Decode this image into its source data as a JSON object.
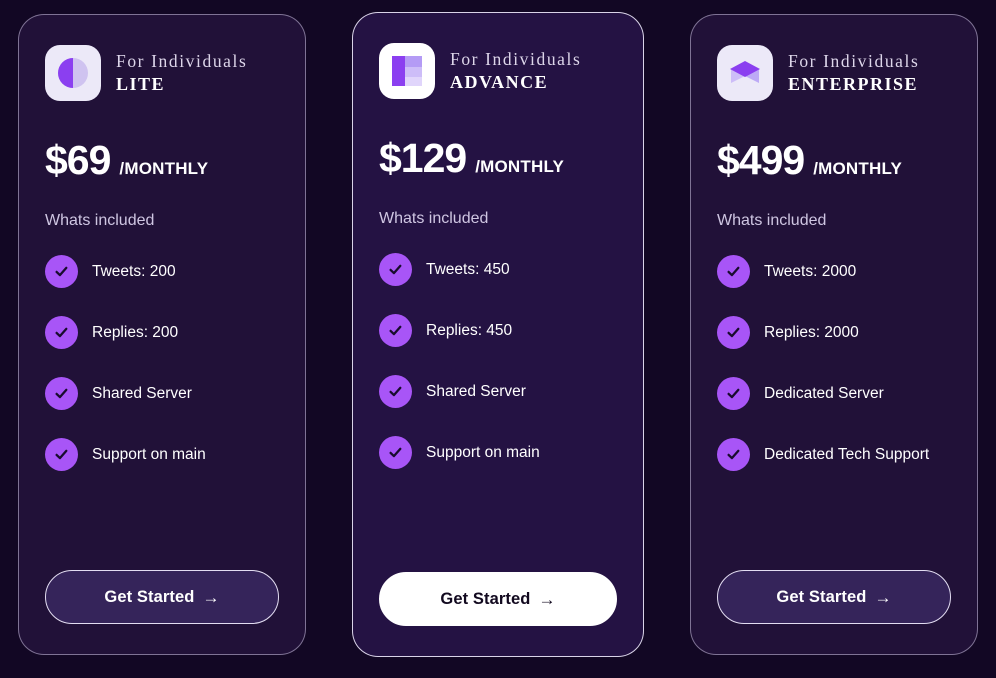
{
  "theme": {
    "page_background": "#120724",
    "card_background": "#211138",
    "featured_card_background": "#241243",
    "accent": "#a855f7",
    "text_primary": "#ffffff",
    "text_muted": "#cfc6e2"
  },
  "plans": [
    {
      "icon_name": "half-circle-icon",
      "audience": "For Individuals",
      "name": "LITE",
      "price": "$69",
      "period": "/MONTHLY",
      "included_label": "Whats included",
      "features": [
        "Tweets: 200",
        "Replies: 200",
        "Shared Server",
        "Support on main"
      ],
      "cta_label": "Get Started",
      "cta_arrow": "→",
      "cta_style": "outline",
      "featured": false
    },
    {
      "icon_name": "split-square-icon",
      "audience": "For Individuals",
      "name": "ADVANCE",
      "price": "$129",
      "period": "/MONTHLY",
      "included_label": "Whats included",
      "features": [
        "Tweets: 450",
        "Replies: 450",
        "Shared Server",
        "Support on main"
      ],
      "cta_label": "Get Started",
      "cta_arrow": "→",
      "cta_style": "solid",
      "featured": true
    },
    {
      "icon_name": "isometric-cube-icon",
      "audience": "For Individuals",
      "name": "ENTERPRISE",
      "price": "$499",
      "period": "/MONTHLY",
      "included_label": "Whats included",
      "features": [
        "Tweets: 2000",
        "Replies: 2000",
        "Dedicated Server",
        "Dedicated Tech Support"
      ],
      "cta_label": "Get Started",
      "cta_arrow": "→",
      "cta_style": "outline",
      "featured": false
    }
  ]
}
